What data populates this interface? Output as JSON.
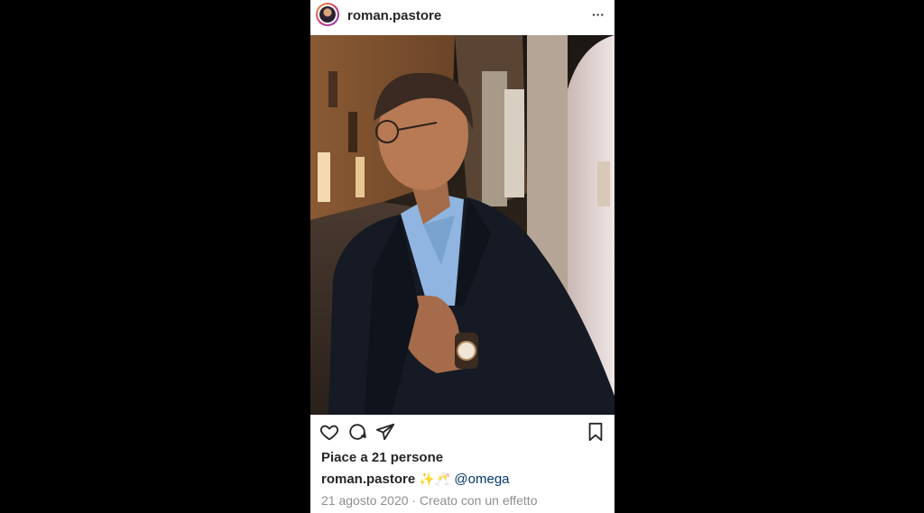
{
  "post": {
    "username": "roman.pastore",
    "more_label": "···",
    "likes_text": "Piace a 21 persone",
    "caption": {
      "username": "roman.pastore",
      "emojis": "✨🥂",
      "mention": "@omega"
    },
    "date": "21 agosto 2020",
    "separator": "·",
    "effect_text": "Creato con un effetto"
  },
  "icons": {
    "avatar": "profile-avatar",
    "more": "more-options-icon",
    "like": "heart-icon",
    "comment": "comment-icon",
    "share": "send-icon",
    "save": "bookmark-icon"
  },
  "colors": {
    "text": "#262626",
    "secondary": "#8e8e8e",
    "mention": "#00376b"
  }
}
